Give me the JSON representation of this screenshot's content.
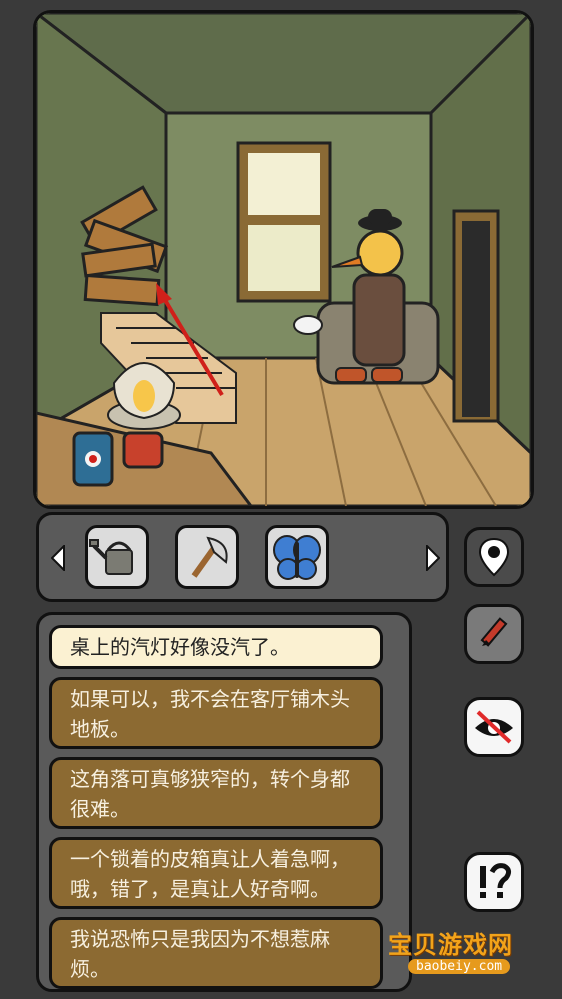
{
  "inventory": {
    "left_arrow": "◀",
    "right_arrow": "▶",
    "items": [
      {
        "name": "watering-can",
        "icon": "watering-can-icon"
      },
      {
        "name": "axe",
        "icon": "axe-icon"
      },
      {
        "name": "butterfly",
        "icon": "butterfly-icon"
      }
    ]
  },
  "side_buttons": [
    {
      "icon": "map-pin-icon"
    },
    {
      "icon": "pencil-icon"
    },
    {
      "icon": "hidden-eye-icon"
    },
    {
      "icon": "hint-icon"
    }
  ],
  "dialog": {
    "lines": [
      {
        "text": "桌上的汽灯好像没汽了。",
        "active": true
      },
      {
        "text": "如果可以，我不会在客厅铺木头地板。",
        "active": false
      },
      {
        "text": "这角落可真够狭窄的，转个身都很难。",
        "active": false
      },
      {
        "text": "一个锁着的皮箱真让人着急啊，哦，错了，是真让人好奇啊。",
        "active": false
      },
      {
        "text": "我说恐怖只是我因为不想惹麻烦。",
        "active": false
      }
    ]
  },
  "watermark": {
    "title": "宝贝游戏网",
    "url": "baobeiy.com"
  }
}
